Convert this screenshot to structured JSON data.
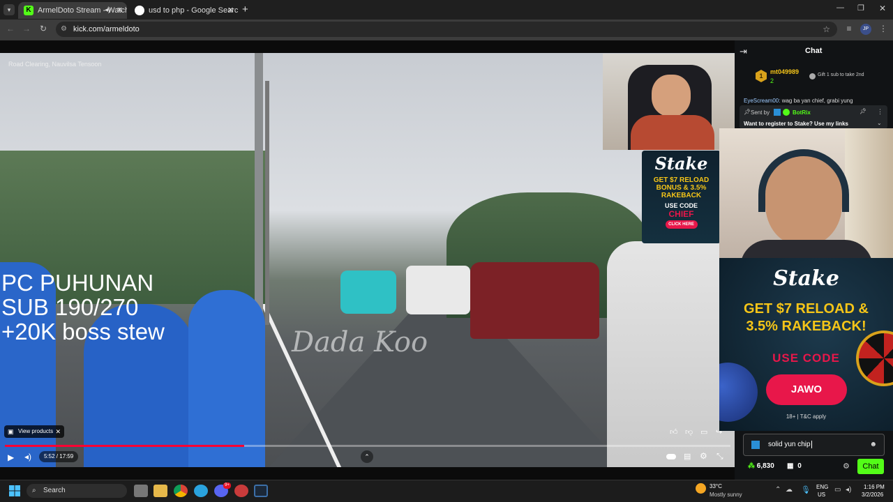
{
  "browser": {
    "tabs": [
      {
        "title": "ArmelDoto Stream - Watch",
        "active": true
      },
      {
        "title": "usd to php - Google Search",
        "active": false
      }
    ],
    "new_tab": "+",
    "url": "kick.com/armeldoto",
    "profile_initials": "JP"
  },
  "video": {
    "location_overlay": "Road Clearing, Nauvilsa Tensoon",
    "watermark": "Dada Koo",
    "overlay_text": "PC PUHUNAN\nSUB 190/270\n+20K boss stew",
    "view_products": "View products",
    "time": "5:52 / 17:59",
    "progress": 0.33
  },
  "ad_small": {
    "brand": "Stake",
    "line1": "GET $7 RELOAD",
    "line2": "BONUS & 3.5%",
    "line3": "RAKEBACK",
    "code_label": "USE CODE",
    "code": "CHIEF",
    "cta": "CLICK HERE"
  },
  "chat": {
    "title": "Chat",
    "top_gifter": {
      "rank": "1",
      "name": "mt049989",
      "count": "2"
    },
    "gift_prompt": "Gift 1 sub to take 2nd",
    "message_user": "EyeScream00:",
    "message_text": "wag ba yan chief, grabi yung",
    "pinned_label": "Sent by",
    "pinned_user": "BotRix",
    "pinned_text": "Want to register to Stake? Use my links",
    "input_value": "solid yun chip",
    "points": "6,830",
    "subs": "0",
    "send_label": "Chat"
  },
  "ad_large": {
    "brand": "Stake",
    "line1": "GET $7 RELOAD &",
    "line2": "3.5% RAKEBACK!",
    "code_label": "USE CODE",
    "code": "JAWO",
    "disclaimer": "18+ | T&C apply"
  },
  "taskbar": {
    "search_label": "Search",
    "weather_temp": "33°C",
    "weather_desc": "Mostly sunny",
    "lang": "ENG",
    "region": "US",
    "time": "1:16 PM",
    "date": "3/2/2026",
    "notif_badge": "9+"
  },
  "colors": {
    "kick_green": "#53fc18",
    "stake_red": "#e8174a",
    "progress_red": "#ff0033"
  }
}
